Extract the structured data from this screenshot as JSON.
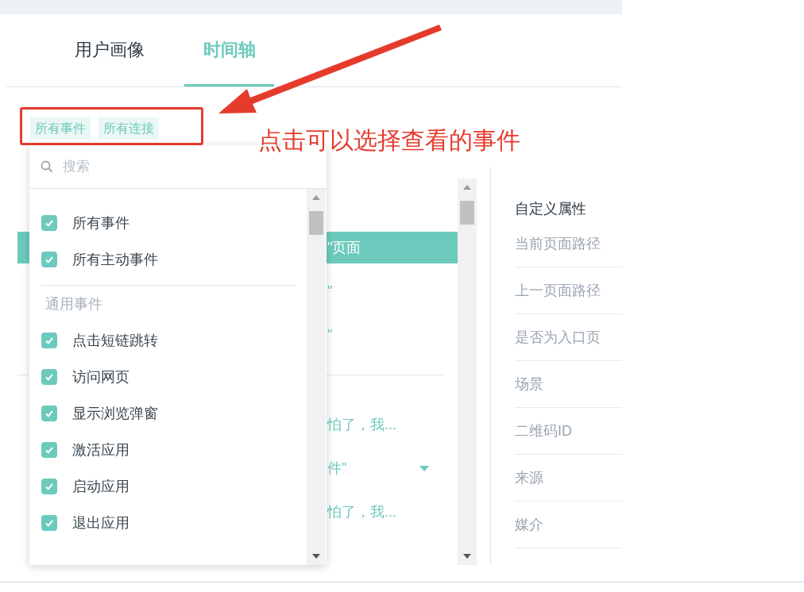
{
  "tabs": [
    {
      "label": "用户画像",
      "selected": false
    },
    {
      "label": "时间轴",
      "selected": true
    }
  ],
  "filters": [
    {
      "label": "所有事件"
    },
    {
      "label": "所有连接"
    }
  ],
  "dropdown": {
    "search": {
      "placeholder": "搜索"
    },
    "top_options": [
      {
        "label": "所有事件",
        "checked": true
      },
      {
        "label": "所有主动事件",
        "checked": true
      }
    ],
    "section": "通用事件",
    "options": [
      {
        "label": "点击短链跳转",
        "checked": true
      },
      {
        "label": "访问网页",
        "checked": true
      },
      {
        "label": "显示浏览弹窗",
        "checked": true
      },
      {
        "label": "激活应用",
        "checked": true
      },
      {
        "label": "启动应用",
        "checked": true
      },
      {
        "label": "退出应用",
        "checked": true
      }
    ]
  },
  "timeline": {
    "groups": [
      [
        {
          "text": "\"页面",
          "selected": true,
          "expandable": false
        },
        {
          "text": "\"",
          "selected": false,
          "expandable": false
        },
        {
          "text": "\"",
          "selected": false,
          "expandable": false
        }
      ],
      [
        {
          "text": "怕了，我...",
          "selected": false,
          "expandable": false
        },
        {
          "text": "件\"",
          "selected": false,
          "expandable": true
        },
        {
          "text": "怕了，我...",
          "selected": false,
          "expandable": false
        }
      ]
    ]
  },
  "properties": {
    "title": "自定义属性",
    "rows": [
      "当前页面路径",
      "上一页面路径",
      "是否为入口页",
      "场景",
      "二维码ID",
      "来源",
      "媒介"
    ]
  },
  "annotation": {
    "caption": "点击可以选择查看的事件"
  }
}
